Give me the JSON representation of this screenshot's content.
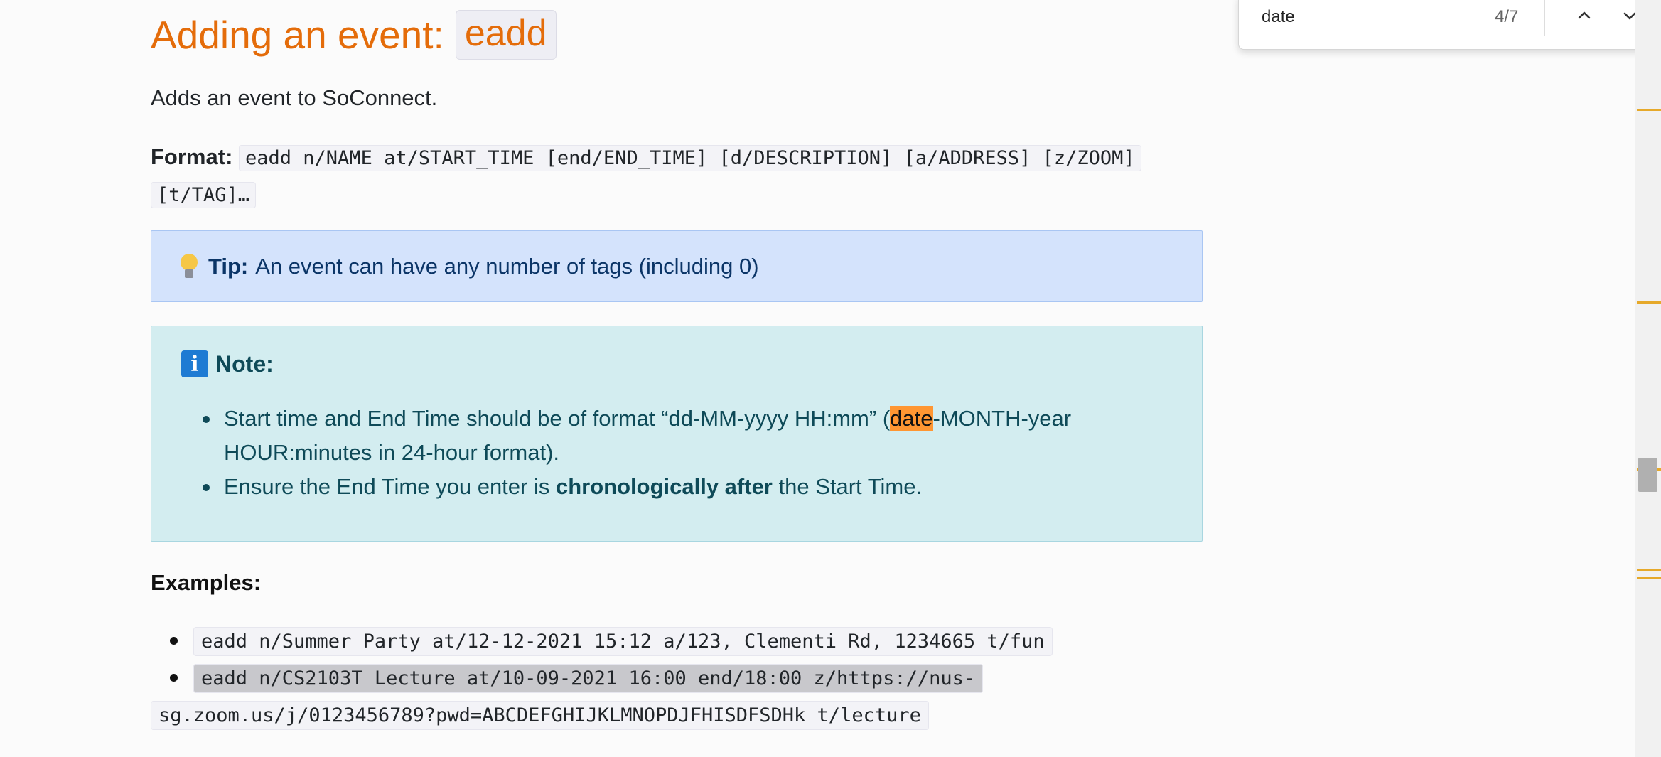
{
  "heading": {
    "text": "Adding an event:",
    "command": "eadd"
  },
  "intro": "Adds an event to SoConnect.",
  "format": {
    "label": "Format:",
    "line1": "eadd n/NAME at/START_TIME [end/END_TIME] [d/DESCRIPTION] [a/ADDRESS] [z/ZOOM]",
    "line2": "[t/TAG]…"
  },
  "tip": {
    "label": "Tip:",
    "text": "An event can have any number of tags (including 0)"
  },
  "note": {
    "label": "Note:",
    "item1_before": "Start time and End Time should be of format “dd-MM-yyyy HH:mm” (",
    "item1_highlight": "date",
    "item1_after_line1": "-MONTH-year",
    "item1_after_line2": "HOUR:minutes in 24-hour format).",
    "item2_before": "Ensure the End Time you enter is ",
    "item2_bold": "chronologically after",
    "item2_after": " the Start Time."
  },
  "examples": {
    "label": "Examples:",
    "items": [
      {
        "line1": "eadd n/Summer Party at/12-12-2021 15:12 a/123, Clementi Rd, 1234665 t/fun"
      },
      {
        "line1": "eadd n/CS2103T Lecture at/10-09-2021 16:00 end/18:00 z/https://nus-",
        "line2": "sg.zoom.us/j/0123456789?pwd=ABCDEFGHIJKLMNOPDJFHISDFSDHk t/lecture"
      }
    ]
  },
  "find_bar": {
    "query": "date",
    "count": "4/7",
    "icons": [
      "chevron-up-icon",
      "chevron-down-icon",
      "close-icon"
    ]
  },
  "colors": {
    "heading": "#e46c0a",
    "tip_bg": "#d4e3fc",
    "note_bg": "#d3edf0",
    "find_highlight": "#ff9632",
    "scroll_marker": "#e6a92a"
  }
}
